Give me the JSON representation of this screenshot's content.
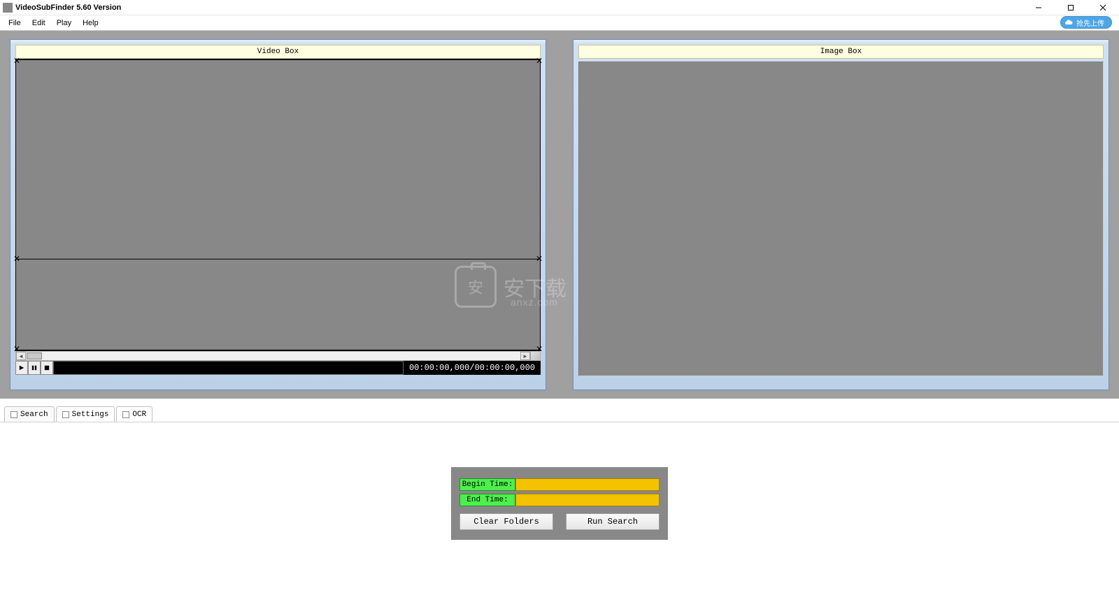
{
  "window": {
    "title": "VideoSubFinder 5.60 Version"
  },
  "menu": {
    "items": [
      "File",
      "Edit",
      "Play",
      "Help"
    ],
    "upload_label": "抢先上传"
  },
  "panels": {
    "video_label": "Video Box",
    "image_label": "Image Box"
  },
  "playbar": {
    "timecodes": "00:00:00,000/00:00:00,000"
  },
  "tabs": [
    {
      "label": "Search"
    },
    {
      "label": "Settings"
    },
    {
      "label": "OCR"
    }
  ],
  "controls": {
    "begin_time_label": "Begin Time:",
    "end_time_label": "End Time:",
    "begin_time_value": "",
    "end_time_value": "",
    "clear_folders": "Clear Folders",
    "run_search": "Run Search"
  },
  "watermark": {
    "text1": "安下载",
    "text2": "anxz.com"
  }
}
